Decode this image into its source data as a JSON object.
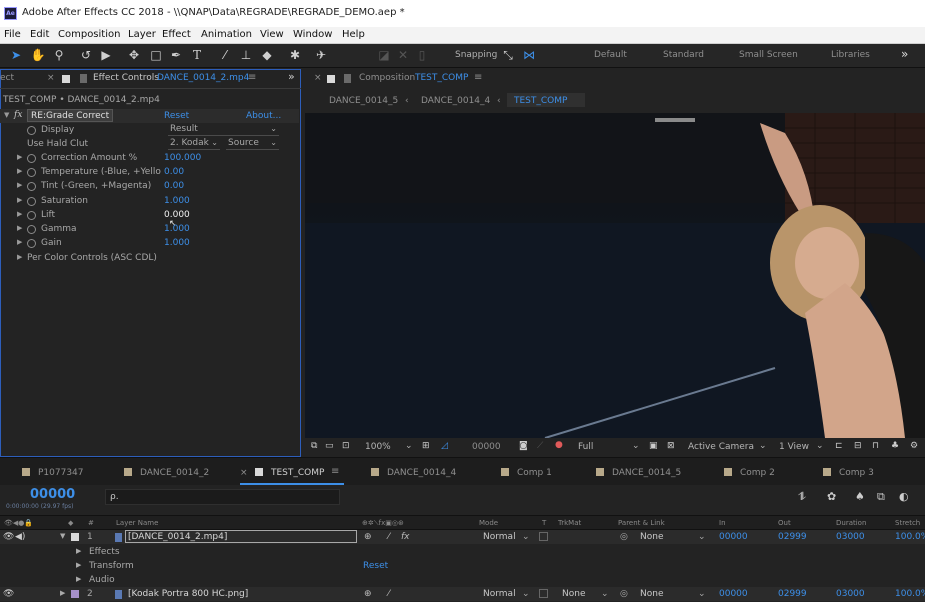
{
  "window": {
    "app_icon": "Ae",
    "title": "Adobe After Effects CC 2018 - \\\\QNAP\\Data\\REGRADE\\REGRADE_DEMO.aep *"
  },
  "menu": [
    "File",
    "Edit",
    "Composition",
    "Layer",
    "Effect",
    "Animation",
    "View",
    "Window",
    "Help"
  ],
  "toolbar": {
    "snapping_label": "Snapping",
    "workspaces": [
      "Default",
      "Standard",
      "Small Screen",
      "Libraries"
    ],
    "overflow": "»"
  },
  "effect_controls": {
    "left_tab_fragment": "ect",
    "tab_label": "Effect Controls",
    "tab_file": "DANCE_0014_2.mp4",
    "breadcrumb": "TEST_COMP • DANCE_0014_2.mp4",
    "effect_name": "RE:Grade Correct",
    "reset": "Reset",
    "about": "About...",
    "display_label": "Display",
    "display_value": "Result",
    "hald_label": "Use Hald Clut",
    "hald_value": "2. Kodak",
    "hald_source": "Source",
    "params": [
      {
        "label": "Correction Amount %",
        "value": "100.000"
      },
      {
        "label": "Temperature (-Blue, +Yello",
        "value": "0.00"
      },
      {
        "label": "Tint (-Green, +Magenta)",
        "value": "0.00"
      },
      {
        "label": "Saturation",
        "value": "1.000"
      },
      {
        "label": "Lift",
        "value": "0.000"
      },
      {
        "label": "Gamma",
        "value": "1.000"
      },
      {
        "label": "Gain",
        "value": "1.000"
      }
    ],
    "per_color": "Per Color Controls (ASC CDL)"
  },
  "composition": {
    "tab_prefix": "Composition",
    "tab_name": "TEST_COMP",
    "crumbs": [
      "DANCE_0014_5",
      "DANCE_0014_4",
      "TEST_COMP"
    ],
    "zoom": "100%",
    "timecode": "00000",
    "resolution": "Full",
    "camera": "Active Camera",
    "views": "1 View"
  },
  "timeline": {
    "tabs": [
      "P1077347",
      "DANCE_0014_2",
      "TEST_COMP",
      "DANCE_0014_4",
      "Comp 1",
      "DANCE_0014_5",
      "Comp 2",
      "Comp 3"
    ],
    "timecode": "00000",
    "timecode_sub": "0:00:00:00 (29.97 fps)",
    "search_placeholder": "ρ.",
    "columns": {
      "layer_name": "Layer Name",
      "mode": "Mode",
      "t": "T",
      "trkmat": "TrkMat",
      "parent": "Parent & Link",
      "in": "In",
      "out": "Out",
      "duration": "Duration",
      "stretch": "Stretch"
    },
    "layers": [
      {
        "num": "1",
        "name": "[DANCE_0014_2.mp4]",
        "mode": "Normal",
        "trkmat": "",
        "parent": "None",
        "in": "00000",
        "out": "02999",
        "duration": "03000",
        "stretch": "100.0%"
      },
      {
        "num": "2",
        "name": "[Kodak Portra 800 HC.png]",
        "mode": "Normal",
        "trkmat": "None",
        "parent": "None",
        "in": "00000",
        "out": "02999",
        "duration": "03000",
        "stretch": "100.0%"
      }
    ],
    "sub_effects": "Effects",
    "sub_transform": "Transform",
    "sub_audio": "Audio",
    "transform_reset": "Reset"
  },
  "colors": {
    "accent": "#3d8fe8",
    "panel_bg": "#232323",
    "focus_border": "#2d5ebb"
  }
}
